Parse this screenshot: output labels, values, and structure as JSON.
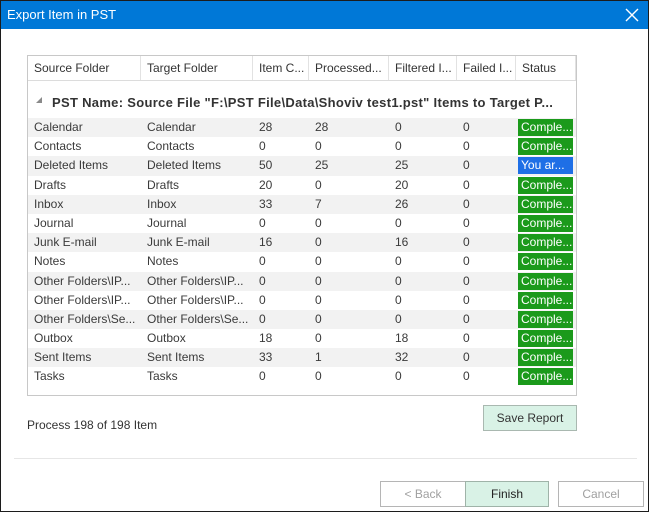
{
  "window": {
    "title": "Export Item in PST",
    "close_icon": "close-icon"
  },
  "grid": {
    "columns": [
      "Source Folder",
      "Target Folder",
      "Item C...",
      "Processed...",
      "Filtered I...",
      "Failed I...",
      "Status"
    ],
    "group_label": "PST Name: Source File \"F:\\PST File\\Data\\Shoviv test1.pst\" Items to Target P...",
    "rows": [
      {
        "source": "Calendar",
        "target": "Calendar",
        "item_count": "28",
        "processed": "28",
        "filtered": "0",
        "failed": "0",
        "status": "Comple...",
        "status_color": "#1b9a1b"
      },
      {
        "source": "Contacts",
        "target": "Contacts",
        "item_count": "0",
        "processed": "0",
        "filtered": "0",
        "failed": "0",
        "status": "Comple...",
        "status_color": "#1b9a1b"
      },
      {
        "source": "Deleted Items",
        "target": "Deleted Items",
        "item_count": "50",
        "processed": "25",
        "filtered": "25",
        "failed": "0",
        "status": "You ar...",
        "status_color": "#1e6fe6"
      },
      {
        "source": "Drafts",
        "target": "Drafts",
        "item_count": "20",
        "processed": "0",
        "filtered": "20",
        "failed": "0",
        "status": "Comple...",
        "status_color": "#1b9a1b"
      },
      {
        "source": "Inbox",
        "target": "Inbox",
        "item_count": "33",
        "processed": "7",
        "filtered": "26",
        "failed": "0",
        "status": "Comple...",
        "status_color": "#1b9a1b"
      },
      {
        "source": "Journal",
        "target": "Journal",
        "item_count": "0",
        "processed": "0",
        "filtered": "0",
        "failed": "0",
        "status": "Comple...",
        "status_color": "#1b9a1b"
      },
      {
        "source": "Junk E-mail",
        "target": "Junk E-mail",
        "item_count": "16",
        "processed": "0",
        "filtered": "16",
        "failed": "0",
        "status": "Comple...",
        "status_color": "#1b9a1b"
      },
      {
        "source": "Notes",
        "target": "Notes",
        "item_count": "0",
        "processed": "0",
        "filtered": "0",
        "failed": "0",
        "status": "Comple...",
        "status_color": "#1b9a1b"
      },
      {
        "source": "Other Folders\\IP...",
        "target": "Other Folders\\IP...",
        "item_count": "0",
        "processed": "0",
        "filtered": "0",
        "failed": "0",
        "status": "Comple...",
        "status_color": "#1b9a1b"
      },
      {
        "source": "Other Folders\\IP...",
        "target": "Other Folders\\IP...",
        "item_count": "0",
        "processed": "0",
        "filtered": "0",
        "failed": "0",
        "status": "Comple...",
        "status_color": "#1b9a1b"
      },
      {
        "source": "Other Folders\\Se...",
        "target": "Other Folders\\Se...",
        "item_count": "0",
        "processed": "0",
        "filtered": "0",
        "failed": "0",
        "status": "Comple...",
        "status_color": "#1b9a1b"
      },
      {
        "source": "Outbox",
        "target": "Outbox",
        "item_count": "18",
        "processed": "0",
        "filtered": "18",
        "failed": "0",
        "status": "Comple...",
        "status_color": "#1b9a1b"
      },
      {
        "source": "Sent Items",
        "target": "Sent Items",
        "item_count": "33",
        "processed": "1",
        "filtered": "32",
        "failed": "0",
        "status": "Comple...",
        "status_color": "#1b9a1b"
      },
      {
        "source": "Tasks",
        "target": "Tasks",
        "item_count": "0",
        "processed": "0",
        "filtered": "0",
        "failed": "0",
        "status": "Comple...",
        "status_color": "#1b9a1b"
      }
    ]
  },
  "footer": {
    "progress_text": "Process 198 of 198 Item",
    "save_report_label": "Save Report",
    "back_label": "< Back",
    "finish_label": "Finish",
    "cancel_label": "Cancel"
  }
}
